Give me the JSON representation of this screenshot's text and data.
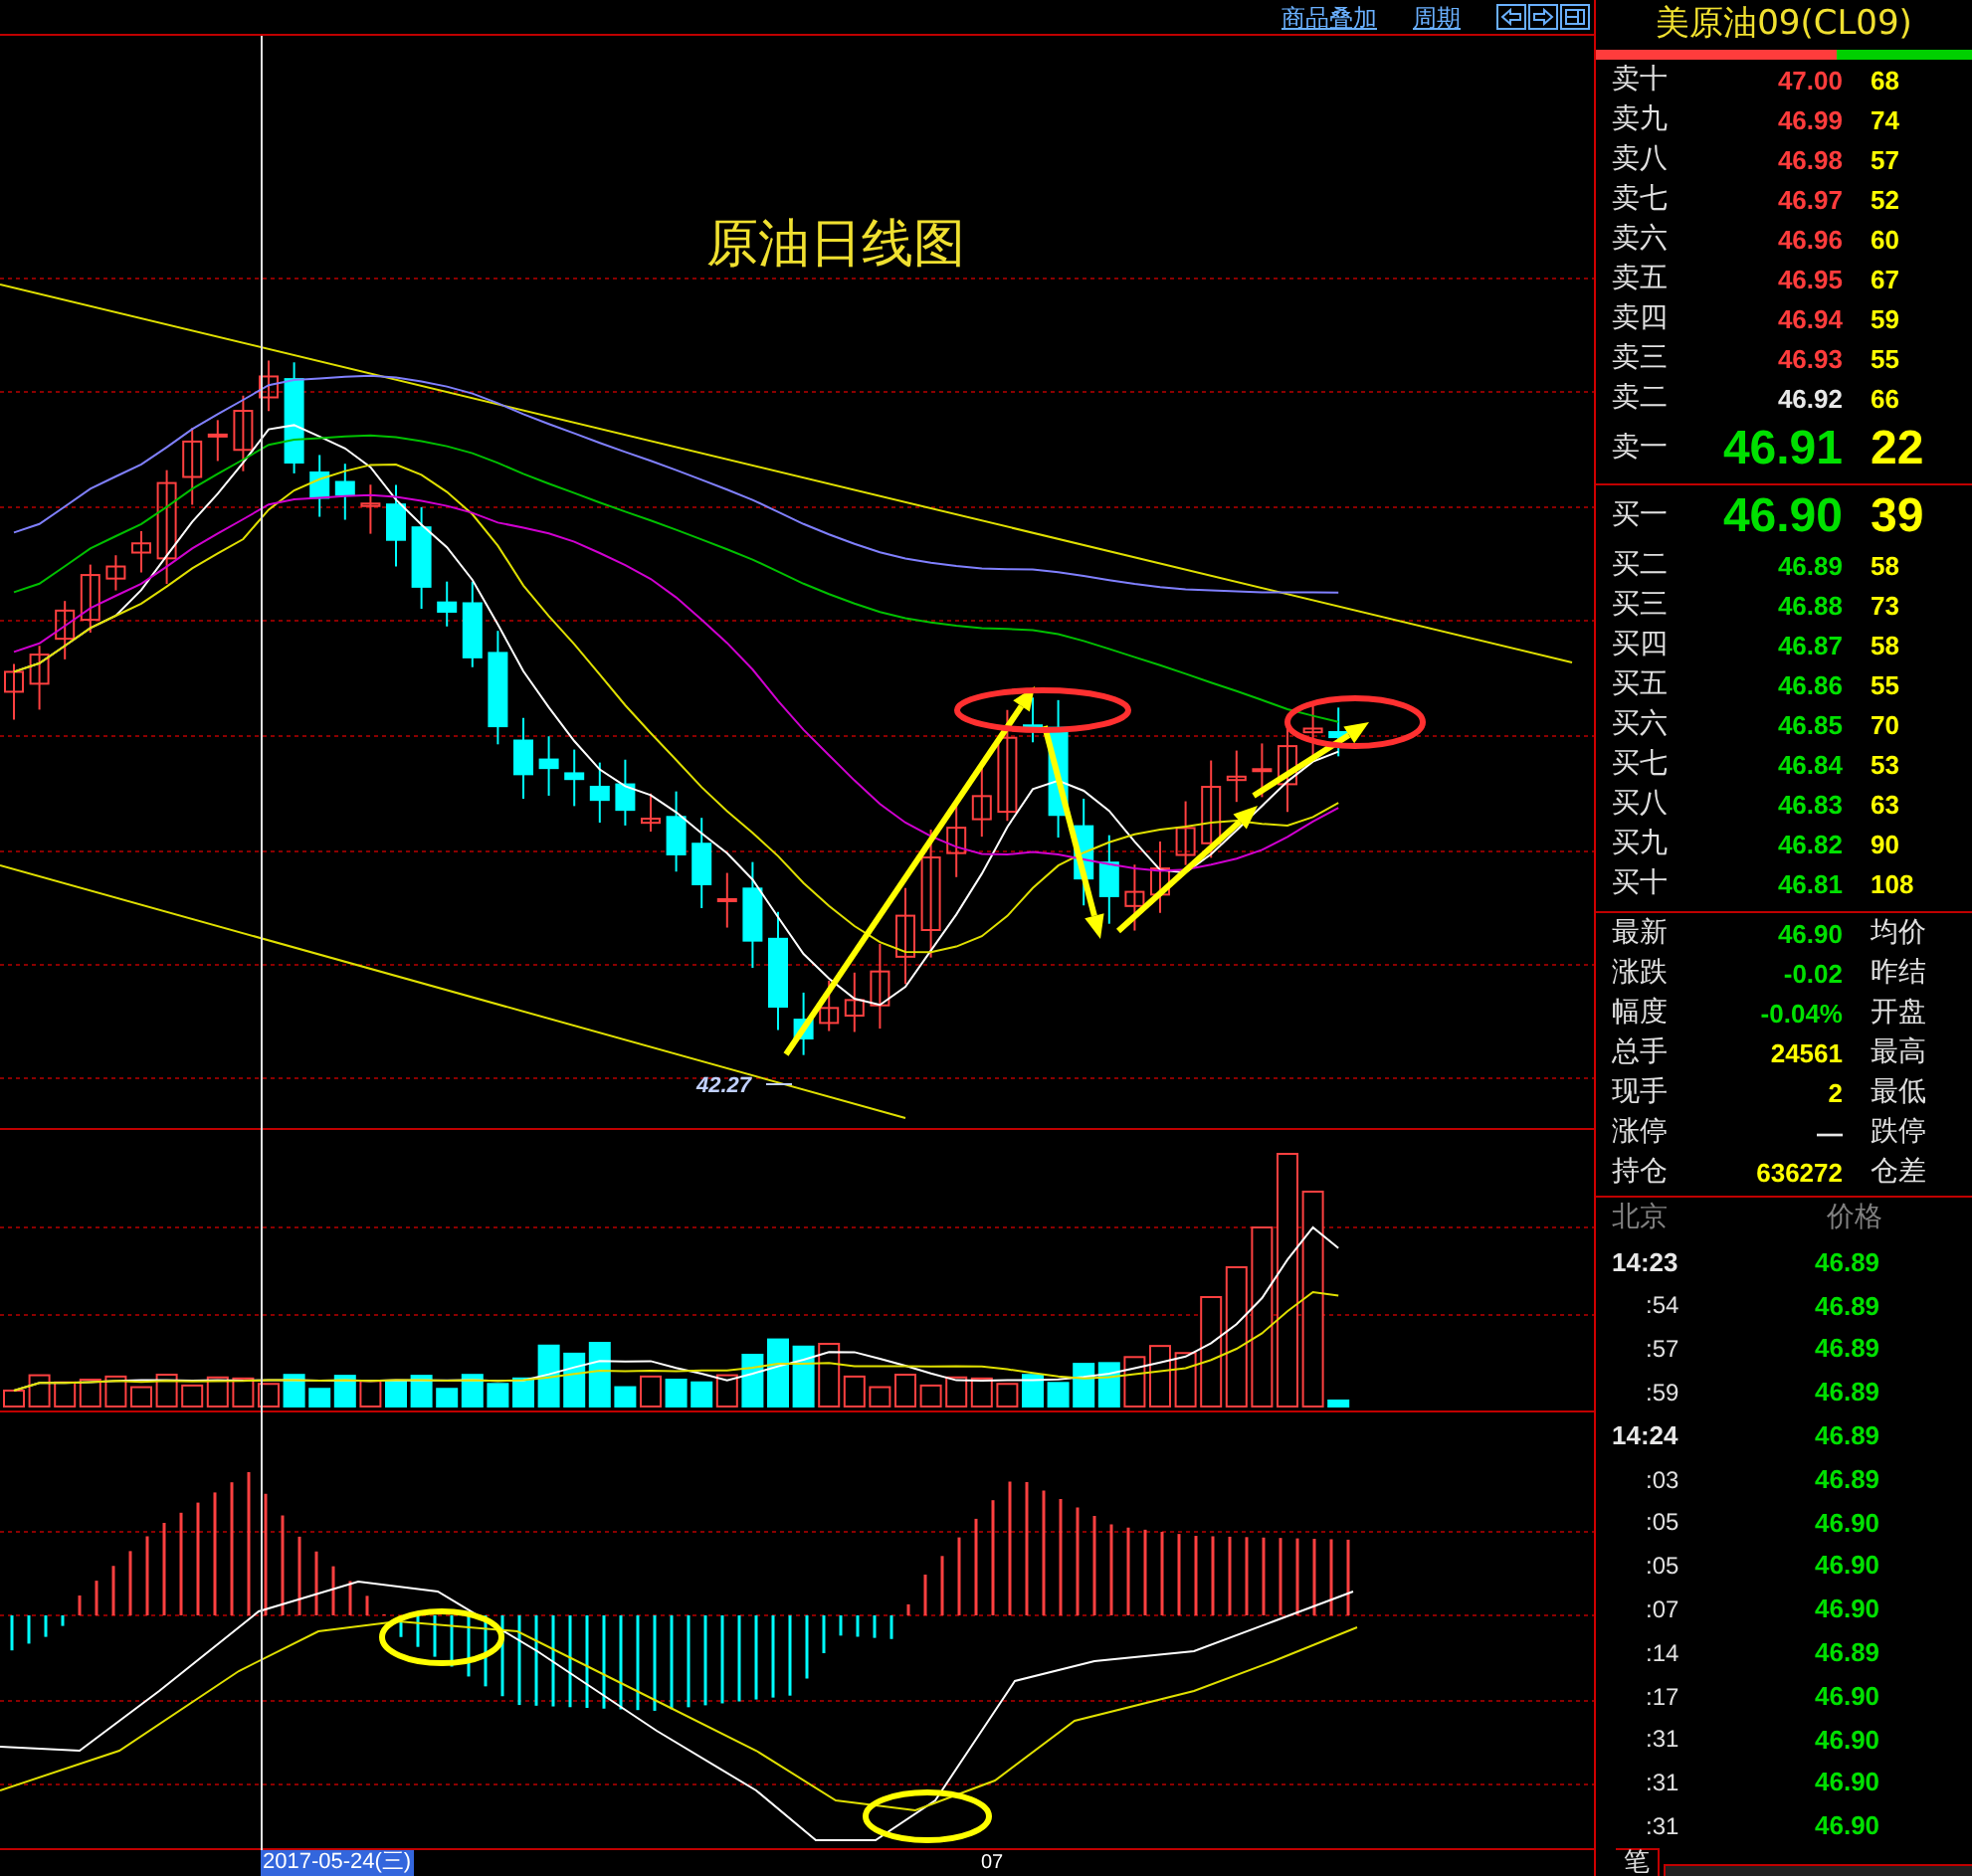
{
  "toolbar": {
    "links": [
      "商品叠加",
      "周期"
    ]
  },
  "chart": {
    "title": "原油日线图",
    "low_label": "42.27",
    "date_label": "2017-05-24(三)",
    "x_label": "07"
  },
  "quote": {
    "title": "美原油09(CL09)",
    "ratio_bar": {
      "level": 0.64
    },
    "asks": [
      {
        "label": "卖十",
        "price": "47.00",
        "volume": "68",
        "color": "#ff3c3c",
        "kind": "normal"
      },
      {
        "label": "卖九",
        "price": "46.99",
        "volume": "74",
        "color": "#ff3c3c",
        "kind": "normal"
      },
      {
        "label": "卖八",
        "price": "46.98",
        "volume": "57",
        "color": "#ff3c3c",
        "kind": "normal"
      },
      {
        "label": "卖七",
        "price": "46.97",
        "volume": "52",
        "color": "#ff3c3c",
        "kind": "normal"
      },
      {
        "label": "卖六",
        "price": "46.96",
        "volume": "60",
        "color": "#ff3c3c",
        "kind": "normal"
      },
      {
        "label": "卖五",
        "price": "46.95",
        "volume": "67",
        "color": "#ff3c3c",
        "kind": "normal"
      },
      {
        "label": "卖四",
        "price": "46.94",
        "volume": "59",
        "color": "#ff3c3c",
        "kind": "normal"
      },
      {
        "label": "卖三",
        "price": "46.93",
        "volume": "55",
        "color": "#ff3c3c",
        "kind": "normal"
      },
      {
        "label": "卖二",
        "price": "46.92",
        "volume": "66",
        "color": "#e8e8e8",
        "kind": "normal"
      },
      {
        "label": "卖一",
        "price": "46.91",
        "volume": "22",
        "color": "#00e000",
        "kind": "best"
      }
    ],
    "bids": [
      {
        "label": "买一",
        "price": "46.90",
        "volume": "39",
        "color": "#00e000",
        "kind": "best"
      },
      {
        "label": "买二",
        "price": "46.89",
        "volume": "58",
        "color": "#00e000",
        "kind": "normal"
      },
      {
        "label": "买三",
        "price": "46.88",
        "volume": "73",
        "color": "#00e000",
        "kind": "normal"
      },
      {
        "label": "买四",
        "price": "46.87",
        "volume": "58",
        "color": "#00e000",
        "kind": "normal"
      },
      {
        "label": "买五",
        "price": "46.86",
        "volume": "55",
        "color": "#00e000",
        "kind": "normal"
      },
      {
        "label": "买六",
        "price": "46.85",
        "volume": "70",
        "color": "#00e000",
        "kind": "normal"
      },
      {
        "label": "买七",
        "price": "46.84",
        "volume": "53",
        "color": "#00e000",
        "kind": "normal"
      },
      {
        "label": "买八",
        "price": "46.83",
        "volume": "63",
        "color": "#00e000",
        "kind": "normal"
      },
      {
        "label": "买九",
        "price": "46.82",
        "volume": "90",
        "color": "#00e000",
        "kind": "normal"
      },
      {
        "label": "买十",
        "price": "46.81",
        "volume": "108",
        "color": "#00e000",
        "kind": "normal"
      }
    ],
    "stats": [
      {
        "label": "最新",
        "value": "46.90",
        "color": "#00e000",
        "label_2": "均价"
      },
      {
        "label": "涨跌",
        "value": "-0.02",
        "color": "#00e000",
        "label_2": "昨结"
      },
      {
        "label": "幅度",
        "value": "-0.04%",
        "color": "#00e000",
        "label_2": "开盘"
      },
      {
        "label": "总手",
        "value": "24561",
        "color": "#ffff00",
        "label_2": "最高"
      },
      {
        "label": "现手",
        "value": "2",
        "color": "#ffff00",
        "label_2": "最低"
      },
      {
        "label": "涨停",
        "value": "—",
        "color": "#e8e8e8",
        "label_2": "跌停"
      },
      {
        "label": "持仓",
        "value": "636272",
        "color": "#ffff00",
        "label_2": "仓差"
      }
    ],
    "ticks_header": [
      "北京",
      "价格"
    ],
    "ticks": [
      {
        "time": "14:23",
        "kind": "minute",
        "price": "46.89"
      },
      {
        "time": ":54",
        "kind": "second",
        "price": "46.89"
      },
      {
        "time": ":57",
        "kind": "second",
        "price": "46.89"
      },
      {
        "time": ":59",
        "kind": "second",
        "price": "46.89"
      },
      {
        "time": "14:24",
        "kind": "minute",
        "price": "46.89"
      },
      {
        "time": ":03",
        "kind": "second",
        "price": "46.89"
      },
      {
        "time": ":05",
        "kind": "second",
        "price": "46.90"
      },
      {
        "time": ":05",
        "kind": "second",
        "price": "46.90"
      },
      {
        "time": ":07",
        "kind": "second",
        "price": "46.90"
      },
      {
        "time": ":14",
        "kind": "second",
        "price": "46.89"
      },
      {
        "time": ":17",
        "kind": "second",
        "price": "46.90"
      },
      {
        "time": ":31",
        "kind": "second",
        "price": "46.90"
      },
      {
        "time": ":31",
        "kind": "second",
        "price": "46.90"
      },
      {
        "time": ":31",
        "kind": "second",
        "price": "46.90"
      }
    ],
    "bottom_tab": "笔"
  }
}
